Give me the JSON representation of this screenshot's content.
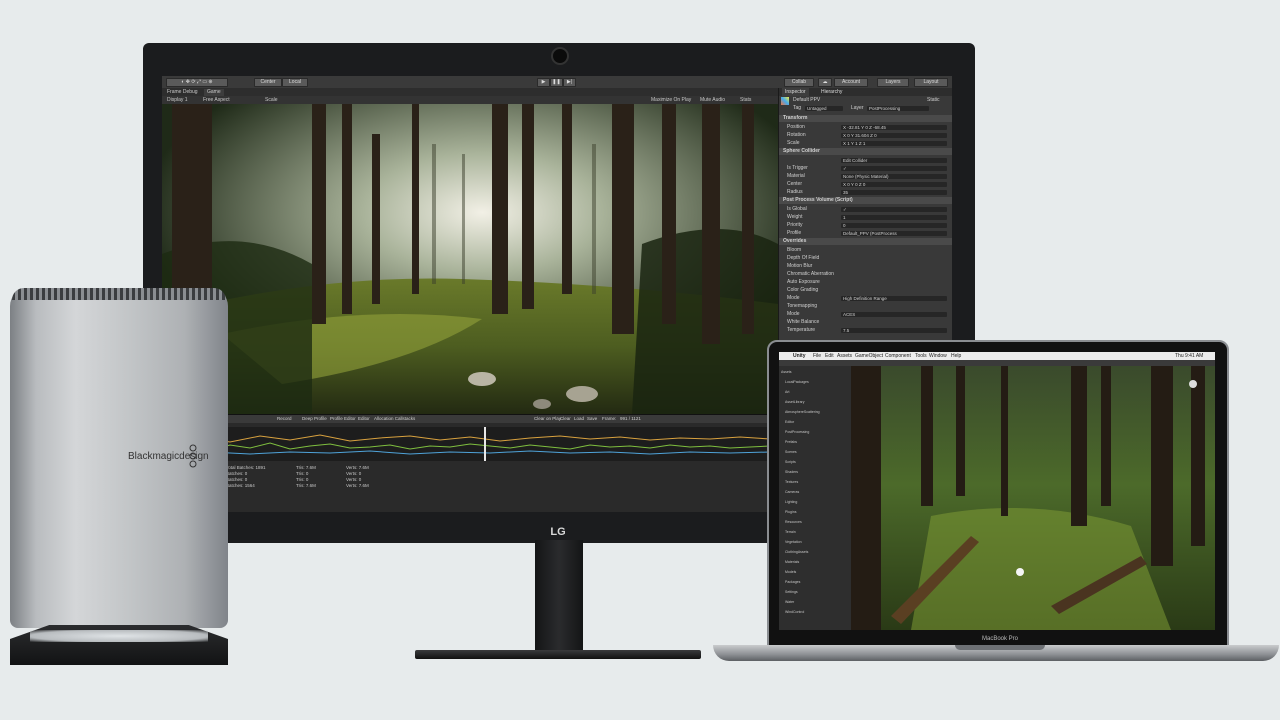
{
  "monitor": {
    "brand": "LG",
    "toolbar": {
      "center_label": "Center",
      "local_label": "Local",
      "collab_label": "Collab",
      "account_label": "Account",
      "layers_label": "Layers",
      "layout_label": "Layout"
    },
    "tabs": {
      "frame_debug": "Frame Debug",
      "game": "Game",
      "display": "Display 1",
      "aspect": "Free Aspect",
      "scale": "Scale",
      "maximize": "Maximize On Play",
      "mute": "Mute Audio",
      "stats": "Stats"
    },
    "inspector": {
      "tab_inspector": "Inspector",
      "tab_hierarchy": "Hierarchy",
      "object_name": "Default PPV",
      "static_label": "Static",
      "tag_label": "Tag",
      "tag_value": "Untagged",
      "layer_label": "Layer",
      "layer_value": "PostProcessing",
      "rows": [
        {
          "label": "Transform",
          "head": true
        },
        {
          "label": "Position",
          "value": "X -32.81   Y 0   Z -68.45"
        },
        {
          "label": "Rotation",
          "value": "X 0   Y 31.604   Z 0"
        },
        {
          "label": "Scale",
          "value": "X 1   Y 1   Z 1"
        },
        {
          "label": "Sphere Collider",
          "head": true
        },
        {
          "label": "",
          "value": "Edit Collider"
        },
        {
          "label": "Is Trigger",
          "value": "✓"
        },
        {
          "label": "Material",
          "value": "None (Physic Material)"
        },
        {
          "label": "Center",
          "value": "X 0   Y 0   Z 0"
        },
        {
          "label": "Radius",
          "value": "35"
        },
        {
          "label": "Post Process Volume (Script)",
          "head": true
        },
        {
          "label": "Is Global",
          "value": "✓"
        },
        {
          "label": "Weight",
          "value": "1"
        },
        {
          "label": "Priority",
          "value": "0"
        },
        {
          "label": "Profile",
          "value": "Default_PPV (PostProcess"
        },
        {
          "label": "Overrides",
          "head": true
        },
        {
          "label": "Bloom"
        },
        {
          "label": "Depth Of Field"
        },
        {
          "label": "Motion Blur"
        },
        {
          "label": "Chromatic Aberration"
        },
        {
          "label": "Auto Exposure"
        },
        {
          "label": "Color Grading"
        },
        {
          "label": "Mode",
          "value": "High Definition Range"
        },
        {
          "label": "Tonemapping"
        },
        {
          "label": "Mode",
          "value": "ACES"
        },
        {
          "label": "White Balance"
        },
        {
          "label": "Temperature",
          "value": "7.5"
        }
      ],
      "profile_new": "New",
      "profile_clone": "Clone"
    },
    "profiler": {
      "tabs": [
        "Record",
        "Deep Profile",
        "Profile Editor",
        "Editor",
        "Allocation Callstacks"
      ],
      "right_tabs": [
        "Clear on Play",
        "Clear",
        "Load",
        "Save",
        "Frame:"
      ],
      "frame_value": "991 / 1121",
      "stats": [
        [
          "Draw Calls: 1891",
          "Total Batches: 1891",
          "Tris: 7.6M",
          "Verts: 7.6M"
        ],
        [
          "Draw Calls: 0",
          "Batches: 0",
          "Tris: 0",
          "Verts: 0"
        ],
        [
          "Draw Calls: 0",
          "Batches: 0",
          "Tris: 0",
          "Verts: 0"
        ],
        [
          "Draw Calls: 4595",
          "Batches: 1564",
          "Tris: 7.6M",
          "Verts: 7.6M"
        ]
      ]
    }
  },
  "egpu": {
    "brand": "Blackmagicdesign"
  },
  "macbook": {
    "label": "MacBook Pro",
    "menubar": {
      "app": "Unity",
      "items": [
        "File",
        "Edit",
        "Assets",
        "GameObject",
        "Component",
        "Tools",
        "Window",
        "Help"
      ],
      "time": "Thu 9:41 AM"
    },
    "hierarchy_items": [
      "Assets",
      "LocalPackages",
      "Art",
      "AssetLibrary",
      "AtmosphereScattering",
      "Editor",
      "PostProcessing",
      "Prefabs",
      "Scenes",
      "Scripts",
      "Shaders",
      "Textures",
      "Cameras",
      "Lighting",
      "Plugins",
      "Resources",
      "Terrain",
      "Vegetation",
      "ClothingAssets",
      "Materials",
      "Models",
      "Packages",
      "Settings",
      "Water",
      "WindControl"
    ]
  },
  "colors": {
    "background": "#e7ebec",
    "unity_panel": "#393939",
    "unity_dark": "#2a2a2a"
  }
}
